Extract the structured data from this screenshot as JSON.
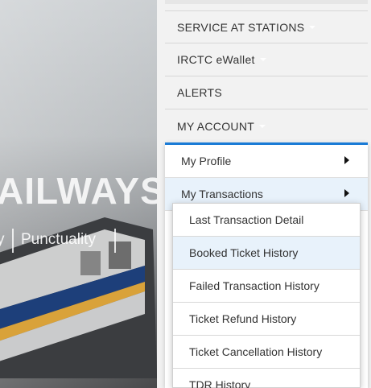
{
  "hero": {
    "title": "AILWAYS",
    "tag_left": "y",
    "tag_right": "Punctuality"
  },
  "menu": {
    "items": [
      {
        "label": "SERVICE AT STATIONS",
        "has_caret": true
      },
      {
        "label": "IRCTC eWallet",
        "has_caret": true
      },
      {
        "label": "ALERTS",
        "has_caret": false
      },
      {
        "label": "MY ACCOUNT",
        "has_caret": true
      }
    ]
  },
  "submenu": {
    "items": [
      {
        "label": "My Profile",
        "icon": "caret-right-icon"
      },
      {
        "label": "My Transactions",
        "icon": "caret-right-icon"
      }
    ]
  },
  "flyout": {
    "items": [
      {
        "label": "Last Transaction Detail"
      },
      {
        "label": "Booked Ticket History"
      },
      {
        "label": "Failed Transaction History"
      },
      {
        "label": "Ticket Refund History"
      },
      {
        "label": "Ticket Cancellation History"
      },
      {
        "label": "TDR History"
      }
    ]
  },
  "colors": {
    "accent": "#1a7bd6",
    "hover_bg": "#e8f2fb"
  }
}
